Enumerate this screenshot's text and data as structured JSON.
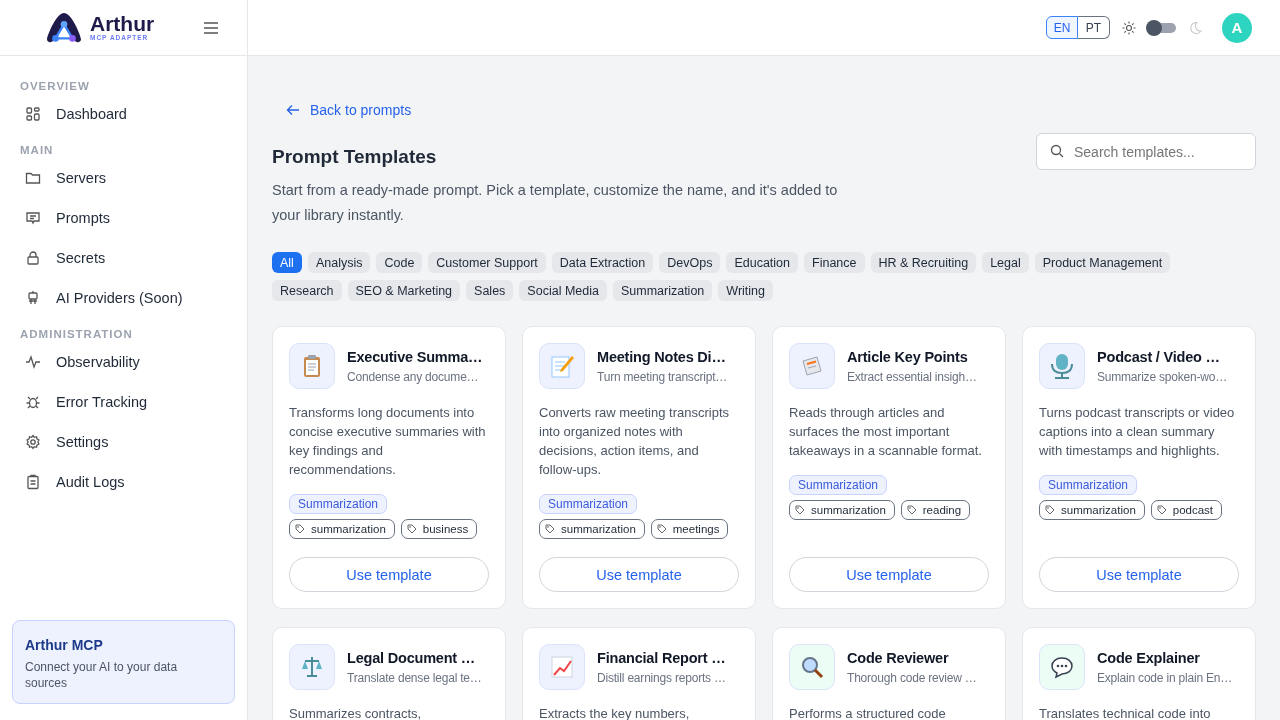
{
  "brand": {
    "name": "Arthur",
    "tagline": "MCP ADAPTER"
  },
  "sidebar": {
    "sections": [
      {
        "title": "OVERVIEW",
        "items": [
          {
            "label": "Dashboard"
          }
        ]
      },
      {
        "title": "MAIN",
        "items": [
          {
            "label": "Servers"
          },
          {
            "label": "Prompts"
          },
          {
            "label": "Secrets"
          },
          {
            "label": "AI Providers (Soon)"
          }
        ]
      },
      {
        "title": "ADMINISTRATION",
        "items": [
          {
            "label": "Observability"
          },
          {
            "label": "Error Tracking"
          },
          {
            "label": "Settings"
          },
          {
            "label": "Audit Logs"
          }
        ]
      }
    ],
    "promo": {
      "title": "Arthur MCP",
      "text": "Connect your AI to your data sources"
    }
  },
  "header": {
    "languages": [
      {
        "label": "EN",
        "selected": true
      },
      {
        "label": "PT",
        "selected": false
      }
    ],
    "dark_mode": {
      "on": false
    },
    "avatar": "A"
  },
  "back_link": "Back to prompts",
  "page": {
    "title": "Prompt Templates",
    "description": "Start from a ready-made prompt. Pick a template, customize the name, and it's added to your library instantly.",
    "search": {
      "placeholder": "Search templates..."
    }
  },
  "filters": [
    {
      "label": "All",
      "selected": true
    },
    {
      "label": "Analysis",
      "selected": false
    },
    {
      "label": "Code",
      "selected": false
    },
    {
      "label": "Customer Support",
      "selected": false
    },
    {
      "label": "Data Extraction",
      "selected": false
    },
    {
      "label": "DevOps",
      "selected": false
    },
    {
      "label": "Education",
      "selected": false
    },
    {
      "label": "Finance",
      "selected": false
    },
    {
      "label": "HR & Recruiting",
      "selected": false
    },
    {
      "label": "Legal",
      "selected": false
    },
    {
      "label": "Product Management",
      "selected": false
    },
    {
      "label": "Research",
      "selected": false
    },
    {
      "label": "SEO & Marketing",
      "selected": false
    },
    {
      "label": "Sales",
      "selected": false
    },
    {
      "label": "Social Media",
      "selected": false
    },
    {
      "label": "Summarization",
      "selected": false
    },
    {
      "label": "Writing",
      "selected": false
    }
  ],
  "templates": [
    {
      "title": "Executive Summa…",
      "subtitle": "Condense any docume…",
      "description": "Transforms long documents into concise executive summaries with key findings and recommendations.",
      "category": "Summarization",
      "tags": [
        "summarization",
        "business"
      ],
      "button": "Use template",
      "color": "#eef2ff"
    },
    {
      "title": "Meeting Notes Di…",
      "subtitle": "Turn meeting transcript…",
      "description": "Converts raw meeting transcripts into organized notes with decisions, action items, and follow-ups.",
      "category": "Summarization",
      "tags": [
        "summarization",
        "meetings"
      ],
      "button": "Use template",
      "color": "#eef2ff"
    },
    {
      "title": "Article Key Points",
      "subtitle": "Extract essential insigh…",
      "description": "Reads through articles and surfaces the most important takeaways in a scannable format.",
      "category": "Summarization",
      "tags": [
        "summarization",
        "reading"
      ],
      "button": "Use template",
      "color": "#eef2ff"
    },
    {
      "title": "Podcast / Video …",
      "subtitle": "Summarize spoken-wo…",
      "description": "Turns podcast transcripts or video captions into a clean summary with timestamps and highlights.",
      "category": "Summarization",
      "tags": [
        "summarization",
        "podcast"
      ],
      "button": "Use template",
      "color": "#eef2ff"
    },
    {
      "title": "Legal Document …",
      "subtitle": "Translate dense legal te…",
      "description": "Summarizes contracts,",
      "color": "#eef2ff"
    },
    {
      "title": "Financial Report …",
      "subtitle": "Distill earnings reports …",
      "description": "Extracts the key numbers,",
      "color": "#eef2ff"
    },
    {
      "title": "Code Reviewer",
      "subtitle": "Thorough code review …",
      "description": "Performs a structured code",
      "color": "#ecfdf5"
    },
    {
      "title": "Code Explainer",
      "subtitle": "Explain code in plain En…",
      "description": "Translates technical code into",
      "color": "#ecfdf5"
    }
  ]
}
